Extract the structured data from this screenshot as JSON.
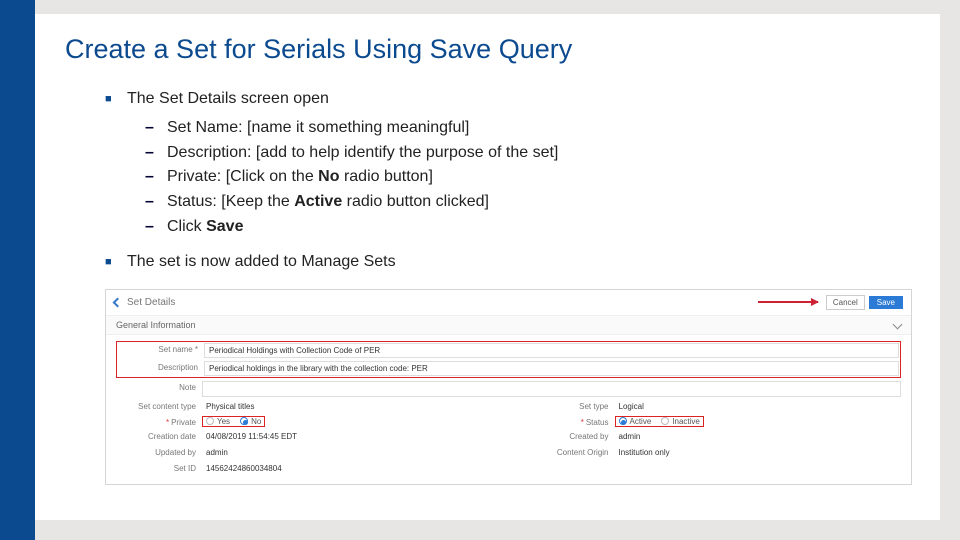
{
  "title": "Create a Set for Serials Using Save Query",
  "bullets": {
    "b1": "The Set Details screen open",
    "sub1": "Set Name: [name it something meaningful]",
    "sub2": "Description: [add to help identify the purpose of the set]",
    "sub3_pre": "Private: [Click on the ",
    "sub3_bold": "No",
    "sub3_post": " radio button]",
    "sub4_pre": "Status: [Keep the ",
    "sub4_bold": "Active",
    "sub4_post": " radio button clicked]",
    "sub5_pre": "Click ",
    "sub5_bold": "Save",
    "b2": "The set is now added to Manage Sets"
  },
  "shot": {
    "pageTitle": "Set Details",
    "cancel": "Cancel",
    "save": "Save",
    "section": "General Information",
    "labels": {
      "setName": "Set name *",
      "description": "Description",
      "note": "Note",
      "contentType": "Set content type",
      "setType": "Set type",
      "private": "Private",
      "status": "Status",
      "creationDate": "Creation date",
      "createdBy": "Created by",
      "updatedBy": "Updated by",
      "contentOrigin": "Content Origin",
      "setId": "Set ID"
    },
    "values": {
      "setName": "Periodical Holdings with Collection Code of PER",
      "description": "Periodical holdings in the library with the collection code: PER",
      "contentType": "Physical titles",
      "setType": "Logical",
      "creationDate": "04/08/2019 11:54:45 EDT",
      "createdBy": "admin",
      "updatedBy": "admin",
      "contentOrigin": "Institution only",
      "setId": "14562424860034804"
    },
    "radios": {
      "yes": "Yes",
      "no": "No",
      "active": "Active",
      "inactive": "Inactive"
    }
  }
}
